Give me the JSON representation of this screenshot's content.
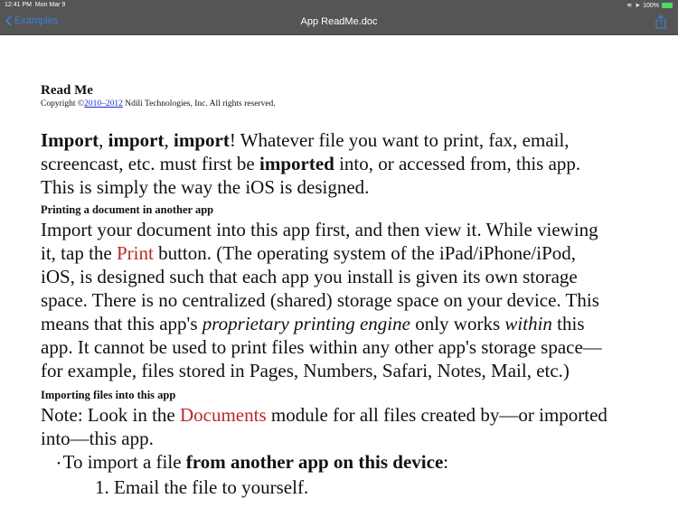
{
  "status_bar": {
    "time": "12:41 PM",
    "date": "Mon Mar 9",
    "battery": "100%"
  },
  "nav": {
    "back_label": "Examples",
    "title": "App ReadMe.doc"
  },
  "doc": {
    "title": "Read Me",
    "copyright_prefix": "Copyright ©",
    "copyright_link": "2010–2012",
    "copyright_suffix": " Ndili Technologies, Inc. All rights reserved.",
    "blocks": [
      {
        "type": "para",
        "lines": [
          [
            {
              "t": "Import",
              "s": "b"
            },
            {
              "t": ", "
            },
            {
              "t": "import",
              "s": "b"
            },
            {
              "t": ", "
            },
            {
              "t": "import",
              "s": "b"
            },
            {
              "t": "! Whatever file you want to print, fax, email,"
            }
          ],
          [
            {
              "t": "screencast, etc. must first be "
            },
            {
              "t": "imported",
              "s": "b"
            },
            {
              "t": " into, or accessed from, this app."
            }
          ],
          [
            {
              "t": "This is simply the way the iOS is designed."
            }
          ]
        ]
      },
      {
        "type": "heading",
        "text": "Printing a document in another app"
      },
      {
        "type": "para",
        "lines": [
          [
            {
              "t": "Import your document into this app first, and then view it. While viewing"
            }
          ],
          [
            {
              "t": "it, tap the "
            },
            {
              "t": "Print",
              "s": "r"
            },
            {
              "t": " button. (The operating system of the iPad/iPhone/iPod,"
            }
          ],
          [
            {
              "t": "iOS, is designed such that each app you install is given its own storage"
            }
          ],
          [
            {
              "t": "space. There is no centralized (shared) storage space on your device. This"
            }
          ],
          [
            {
              "t": "means that this app's "
            },
            {
              "t": "proprietary printing engine",
              "s": "i"
            },
            {
              "t": " only works "
            },
            {
              "t": "within",
              "s": "i"
            },
            {
              "t": " this"
            }
          ],
          [
            {
              "t": "app. It cannot be used to print files within any other app's storage space—"
            }
          ],
          [
            {
              "t": "for example, files stored in Pages, Numbers, Safari, Notes, Mail, etc.)"
            }
          ]
        ]
      },
      {
        "type": "heading",
        "text": "Importing files into this app"
      },
      {
        "type": "para",
        "lines": [
          [
            {
              "t": "Note: Look in the "
            },
            {
              "t": "Documents",
              "s": "r"
            },
            {
              "t": " module for all files created by—or imported"
            }
          ],
          [
            {
              "t": "into—this app."
            }
          ]
        ]
      },
      {
        "type": "para",
        "kind": "bullet",
        "lines": [
          [
            {
              "t": "• ",
              "s": "dot"
            },
            {
              "t": "To import a file "
            },
            {
              "t": "from another app on this device",
              "s": "b"
            },
            {
              "t": ":"
            }
          ]
        ]
      },
      {
        "type": "para",
        "kind": "num",
        "lines": [
          [
            {
              "t": "1. Email the file to yourself."
            }
          ]
        ]
      }
    ]
  }
}
